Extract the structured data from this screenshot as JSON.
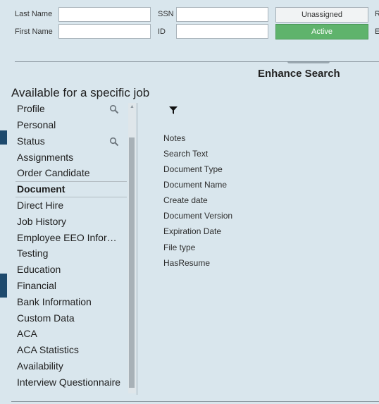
{
  "form": {
    "last_name_label": "Last Name",
    "first_name_label": "First Name",
    "ssn_label": "SSN",
    "id_label": "ID",
    "last_name_value": "",
    "first_name_value": "",
    "ssn_value": "",
    "id_value": "",
    "unassigned_label": "Unassigned",
    "active_label": "Active",
    "right_edge_label_1": "R",
    "right_edge_label_2": "E"
  },
  "enhance_search_label": "Enhance Search",
  "panel_title": "Available for a specific job",
  "categories": [
    "Profile",
    "Personal",
    "Status",
    "Assignments",
    "Order Candidate",
    "Document",
    "Direct Hire",
    "Job History",
    "Employee EEO Infor…",
    "Testing",
    "Education",
    "Financial",
    "Bank Information",
    "Custom Data",
    "ACA",
    "ACA Statistics",
    "Availability",
    "Interview Questionnaire"
  ],
  "selected_category": "Document",
  "fields": [
    "Notes",
    "Search Text",
    "Document Type",
    "Document Name",
    "Create date",
    "Document Version",
    "Expiration Date",
    "File type",
    "HasResume"
  ],
  "colors": {
    "background": "#d9e6ed",
    "active_button": "#5fb36c",
    "side_marker": "#1e4a6d"
  },
  "icons": {
    "search": "magnifier",
    "filter": "funnel",
    "scroll_up": "triangle-up"
  }
}
